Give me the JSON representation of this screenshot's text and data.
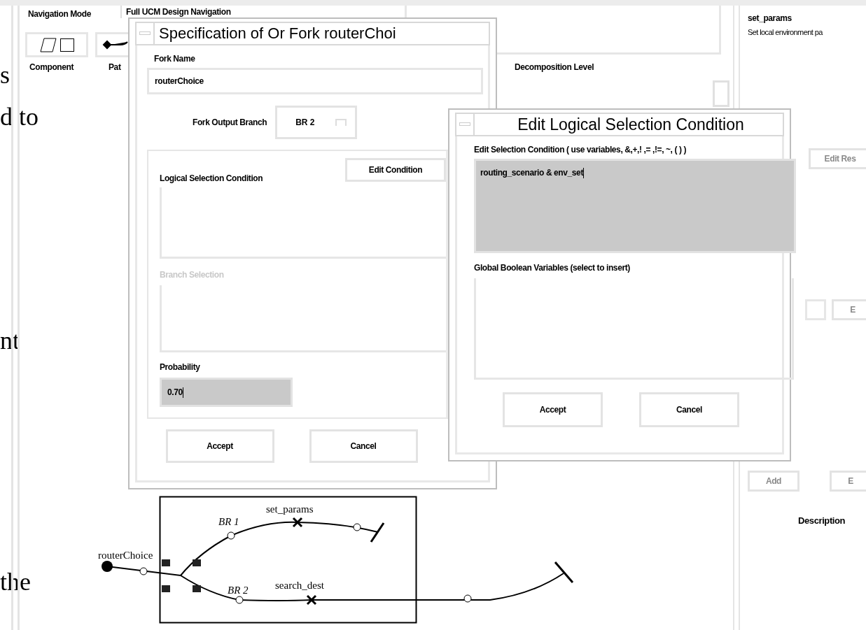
{
  "document_fragments": [
    "s",
    "d to",
    "nt",
    "the"
  ],
  "main_window": {
    "navigation_label": "Navigation Mode",
    "tab": "Full UCM Design Navigation",
    "toolbar_labels": [
      "Component",
      "Pat"
    ],
    "decomposition_label": "Decomposition Level",
    "responsibility": {
      "name": "set_params",
      "description": "Set local environment pa"
    },
    "buttons": [
      {
        "label": "Edit Res",
        "disabled": true
      },
      {
        "label": "E",
        "disabled": true
      },
      {
        "label": "Add",
        "disabled": true
      },
      {
        "label": "E",
        "disabled": true
      }
    ],
    "description_label": "Description"
  },
  "fork_dialog": {
    "title": "Specification of Or Fork routerChoi",
    "fork_name_label": "Fork Name",
    "fork_name": "routerChoice",
    "output_branch_label": "Fork Output Branch",
    "output_branch": "BR 2",
    "condition_label": "Logical Selection Condition",
    "edit_condition_button": "Edit Condition",
    "branch_selection": {
      "label": "Branch Selection",
      "disabled": true
    },
    "probability_label": "Probability",
    "probability": "0.70",
    "buttons": [
      "Accept",
      "Cancel"
    ]
  },
  "condition_dialog": {
    "title": "Edit Logical Selection Condition",
    "condition_label": "Edit Selection Condition ( use variables, &,+,! ,= ,!=, ~, ( ) )",
    "condition": "routing_scenario & env_set",
    "variables_label": "Global Boolean Variables (select to insert)",
    "buttons": [
      "Accept",
      "Cancel"
    ]
  },
  "diagram": {
    "start_label": "routerChoice",
    "branches": [
      {
        "label": "BR 1",
        "responsibility": "set_params"
      },
      {
        "label": "BR 2",
        "responsibility": "search_dest"
      }
    ]
  }
}
